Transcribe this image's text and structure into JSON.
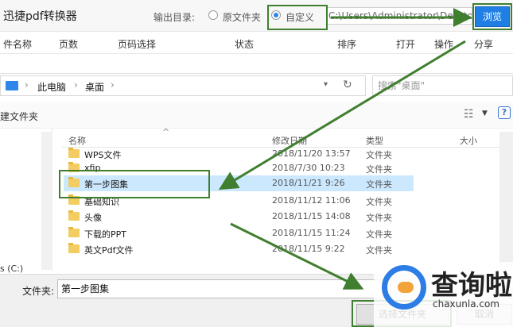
{
  "app": {
    "title": "迅捷pdf转换器"
  },
  "output": {
    "label": "输出目录:",
    "opt_original": "原文件夹",
    "opt_custom": "自定义",
    "path": "C:\\Users\\Administrator\\Deskto",
    "browse": "浏览"
  },
  "columns": [
    "件名称",
    "页数",
    "页码选择",
    "状态",
    "排序",
    "打开",
    "操作",
    "分享"
  ],
  "dialog": {
    "breadcrumb": [
      "此电脑",
      "桌面"
    ],
    "search_placeholder": "搜索\"桌面\"",
    "new_folder": "建文件夹",
    "headers": {
      "name": "名称",
      "date": "修改日期",
      "type": "类型",
      "size": "大小"
    },
    "left_drive": "s (C:)",
    "rows": [
      {
        "name": "WPS文件",
        "date": "2018/11/20 13:57",
        "type": "文件夹"
      },
      {
        "name": "xfip",
        "date": "2018/7/30 10:23",
        "type": "文件夹"
      },
      {
        "name": "第一步图集",
        "date": "2018/11/21 9:26",
        "type": "文件夹"
      },
      {
        "name": "基础知识",
        "date": "2018/11/12 11:06",
        "type": "文件夹"
      },
      {
        "name": "头像",
        "date": "2018/11/15 14:08",
        "type": "文件夹"
      },
      {
        "name": "下载的PPT",
        "date": "2018/11/15 11:24",
        "type": "文件夹"
      },
      {
        "name": "英文Pdf文件",
        "date": "2018/11/15 9:22",
        "type": "文件夹"
      }
    ],
    "folder_label": "文件夹:",
    "folder_value": "第一步图集",
    "select_btn": "选择文件夹",
    "cancel_btn": "取消"
  },
  "watermark": {
    "text": "查询啦",
    "url": "chaxunla.com"
  },
  "colors": {
    "accent": "#1f7fe4",
    "highlight": "#3f7f2f",
    "selection": "#cce8ff"
  }
}
